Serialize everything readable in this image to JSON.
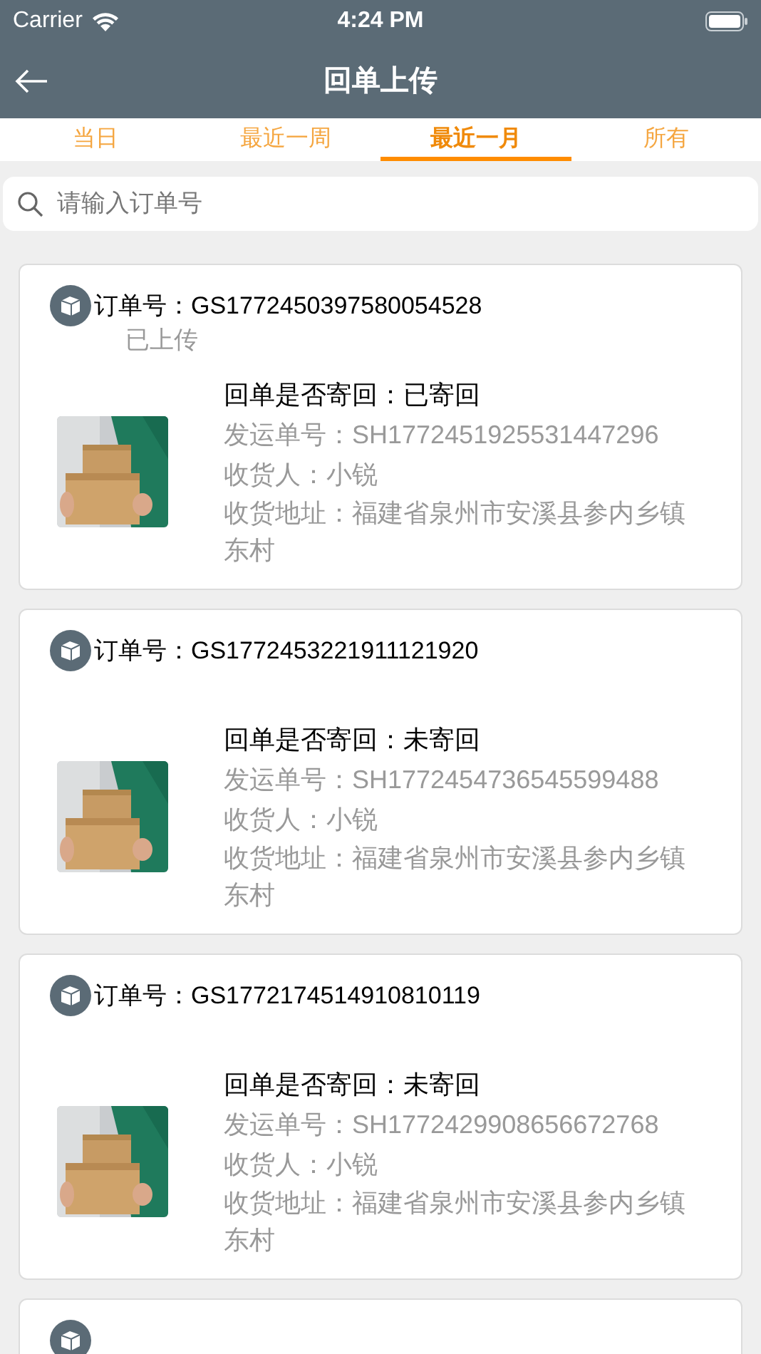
{
  "status_bar": {
    "carrier": "Carrier",
    "time": "4:24 PM"
  },
  "nav": {
    "title": "回单上传"
  },
  "tabs": [
    {
      "label": "当日",
      "selected": false
    },
    {
      "label": "最近一周",
      "selected": false
    },
    {
      "label": "最近一月",
      "selected": true
    },
    {
      "label": "所有",
      "selected": false
    }
  ],
  "search": {
    "placeholder": "请输入订单号"
  },
  "orders": [
    {
      "kind": "full",
      "order_no": "订单号：GS1772450397580054528",
      "upload_status": "已上传",
      "return_status": "回单是否寄回：已寄回",
      "shipment_no": "发运单号：SH1772451925531447296",
      "consignee": "收货人：小锐",
      "address": "收货地址：福建省泉州市安溪县参内乡镇东村"
    },
    {
      "kind": "full",
      "order_no": "订单号：GS1772453221911121920",
      "return_status": "回单是否寄回：未寄回",
      "shipment_no": "发运单号：SH1772454736545599488",
      "consignee": "收货人：小锐",
      "address": "收货地址：福建省泉州市安溪县参内乡镇东村"
    },
    {
      "kind": "full",
      "order_no": "订单号：GS1772174514910810119",
      "return_status": "回单是否寄回：未寄回",
      "shipment_no": "发运单号：SH1772429908656672768",
      "consignee": "收货人：小锐",
      "address": "收货地址：福建省泉州市安溪县参内乡镇东村"
    },
    {
      "kind": "partial"
    }
  ]
}
